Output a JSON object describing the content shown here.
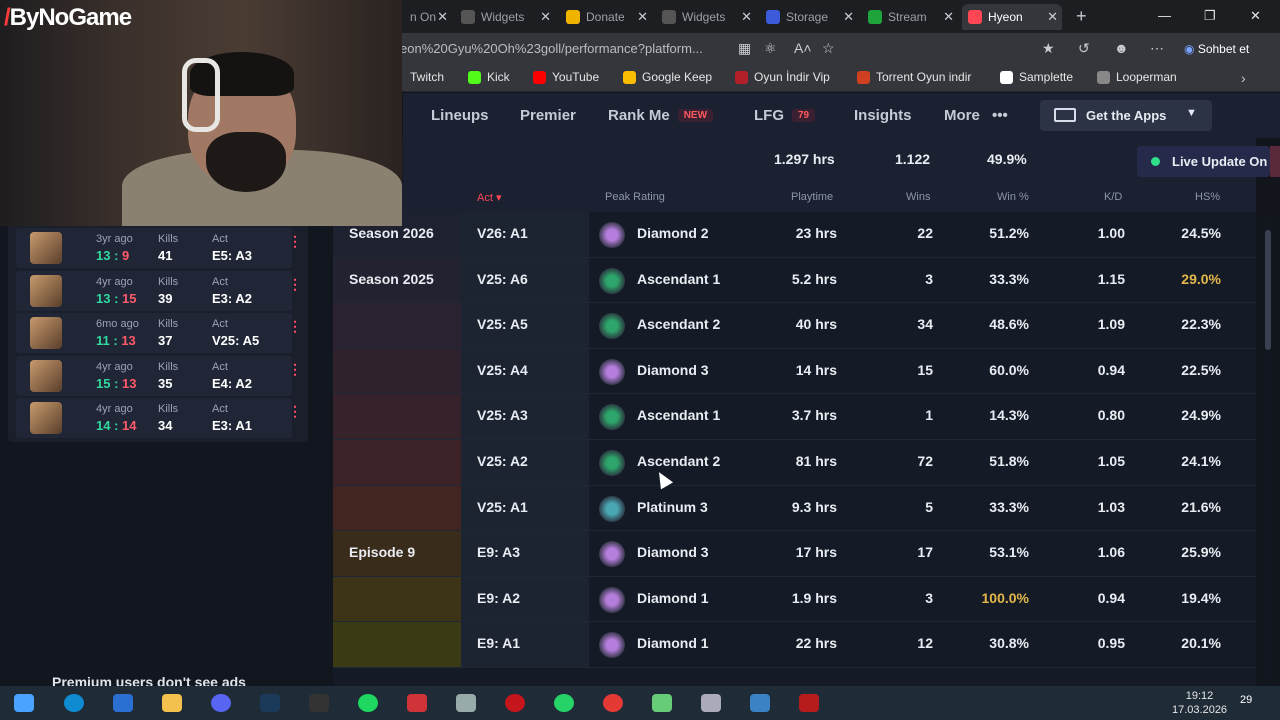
{
  "browser": {
    "tabs": [
      {
        "label": "",
        "fragment": "n On",
        "color": "#555"
      },
      {
        "label": "Widgets",
        "color": "#555"
      },
      {
        "label": "Donate",
        "color": "#f0b400"
      },
      {
        "label": "Widgets",
        "color": "#555"
      },
      {
        "label": "Storage",
        "color": "#3b5bdb"
      },
      {
        "label": "Stream",
        "color": "#1fa33b"
      },
      {
        "label": "Hyeon",
        "color": "#ff4655",
        "active": true
      }
    ],
    "url": "eon%20Gyu%20Oh%23goll/performance?platform...",
    "profile_label": "Sohbet et",
    "bookmarks": [
      {
        "label": "Twitch",
        "color": "#9146ff"
      },
      {
        "label": "Kick",
        "color": "#53fc18"
      },
      {
        "label": "YouTube",
        "color": "#ff0000"
      },
      {
        "label": "Google Keep",
        "color": "#fbbc04"
      },
      {
        "label": "Oyun İndir Vip",
        "color": "#b3202a"
      },
      {
        "label": "Torrent Oyun indir",
        "color": "#d04020"
      },
      {
        "label": "Samplette",
        "color": "#ffffff"
      },
      {
        "label": "Looperman",
        "color": "#888888"
      }
    ]
  },
  "logo": "ByNoGame",
  "nav": {
    "items": [
      "Lineups",
      "Premier",
      "Rank Me",
      "LFG",
      "Insights",
      "More"
    ],
    "rankme_badge": "NEW",
    "lfg_badge": "79",
    "get_apps": "Get the Apps"
  },
  "summary": {
    "playtime": "1.297 hrs",
    "wins": "1.122",
    "winpct": "49.9%",
    "live_update": "Live Update On"
  },
  "table": {
    "headers": {
      "act": "Act",
      "peak": "Peak Rating",
      "playtime": "Playtime",
      "wins": "Wins",
      "winpct": "Win %",
      "kd": "K/D",
      "hs": "HS%"
    },
    "rows": [
      {
        "season": "Season 2026",
        "act": "V26: A1",
        "rank": "Diamond 2",
        "rank_color": "#b57edc",
        "playtime": "23 hrs",
        "wins": "22",
        "winpct": "51.2%",
        "kd": "1.00",
        "hs": "24.5%"
      },
      {
        "season": "Season 2025",
        "act": "V25: A6",
        "rank": "Ascendant 1",
        "rank_color": "#2ea56b",
        "playtime": "5.2 hrs",
        "wins": "3",
        "winpct": "33.3%",
        "kd": "1.15",
        "hs": "29.0%",
        "hs_highlight": true
      },
      {
        "season": "",
        "act": "V25: A5",
        "rank": "Ascendant 2",
        "rank_color": "#2ea56b",
        "playtime": "40 hrs",
        "wins": "34",
        "winpct": "48.6%",
        "kd": "1.09",
        "hs": "22.3%"
      },
      {
        "season": "",
        "act": "V25: A4",
        "rank": "Diamond 3",
        "rank_color": "#b57edc",
        "playtime": "14 hrs",
        "wins": "15",
        "winpct": "60.0%",
        "kd": "0.94",
        "hs": "22.5%"
      },
      {
        "season": "",
        "act": "V25: A3",
        "rank": "Ascendant 1",
        "rank_color": "#2ea56b",
        "playtime": "3.7 hrs",
        "wins": "1",
        "winpct": "14.3%",
        "kd": "0.80",
        "hs": "24.9%"
      },
      {
        "season": "",
        "act": "V25: A2",
        "rank": "Ascendant 2",
        "rank_color": "#2ea56b",
        "playtime": "81 hrs",
        "wins": "72",
        "winpct": "51.8%",
        "kd": "1.05",
        "hs": "24.1%"
      },
      {
        "season": "",
        "act": "V25: A1",
        "rank": "Platinum 3",
        "rank_color": "#4aa8b5",
        "playtime": "9.3 hrs",
        "wins": "5",
        "winpct": "33.3%",
        "kd": "1.03",
        "hs": "21.6%"
      },
      {
        "season": "Episode 9",
        "act": "E9: A3",
        "rank": "Diamond 3",
        "rank_color": "#b57edc",
        "playtime": "17 hrs",
        "wins": "17",
        "winpct": "53.1%",
        "kd": "1.06",
        "hs": "25.9%"
      },
      {
        "season": "",
        "act": "E9: A2",
        "rank": "Diamond 1",
        "rank_color": "#b57edc",
        "playtime": "1.9 hrs",
        "wins": "3",
        "winpct": "100.0%",
        "kd": "0.94",
        "hs": "19.4%",
        "winpct_highlight": true
      },
      {
        "season": "",
        "act": "E9: A1",
        "rank": "Diamond 1",
        "rank_color": "#b57edc",
        "playtime": "22 hrs",
        "wins": "12",
        "winpct": "30.8%",
        "kd": "0.95",
        "hs": "20.1%"
      }
    ]
  },
  "matches": [
    {
      "ago": "3yr ago",
      "w": "13",
      "l": "9",
      "kills_label": "Kills",
      "kills": "41",
      "act_label": "Act",
      "act": "E5: A3"
    },
    {
      "ago": "4yr ago",
      "w": "13",
      "l": "15",
      "kills_label": "Kills",
      "kills": "39",
      "act_label": "Act",
      "act": "E3: A2"
    },
    {
      "ago": "6mo ago",
      "w": "11",
      "l": "13",
      "kills_label": "Kills",
      "kills": "37",
      "act_label": "Act",
      "act": "V25: A5"
    },
    {
      "ago": "4yr ago",
      "w": "15",
      "l": "13",
      "kills_label": "Kills",
      "kills": "35",
      "act_label": "Act",
      "act": "E4: A2"
    },
    {
      "ago": "4yr ago",
      "w": "14",
      "l": "14",
      "kills_label": "Kills",
      "kills": "34",
      "act_label": "Act",
      "act": "E3: A1"
    }
  ],
  "premium_note": "Premium users don't see ads",
  "taskbar": {
    "time": "19:12",
    "date": "17.03.2026",
    "notifications": "29"
  }
}
